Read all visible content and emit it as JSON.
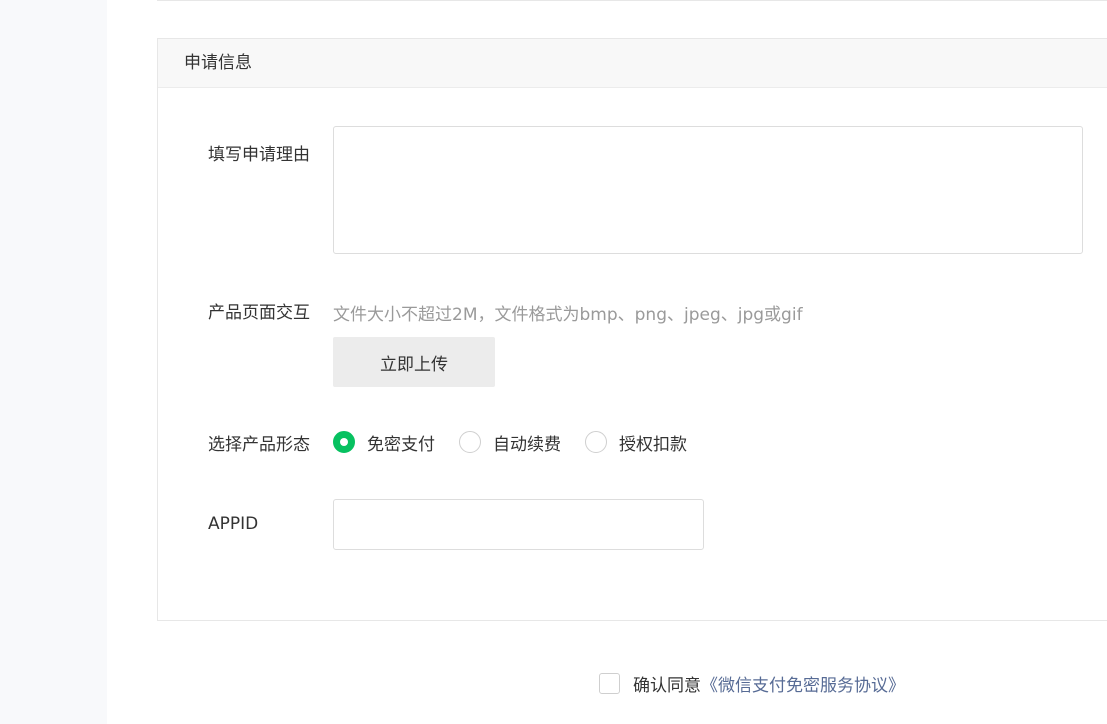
{
  "section": {
    "title": "申请信息"
  },
  "form": {
    "reason": {
      "label": "填写申请理由",
      "value": "",
      "placeholder": ""
    },
    "product_page": {
      "label": "产品页面交互",
      "hint": "文件大小不超过2M，文件格式为bmp、png、jpeg、jpg或gif",
      "upload_label": "立即上传"
    },
    "product_form": {
      "label": "选择产品形态",
      "options": [
        {
          "label": "免密支付",
          "checked": true
        },
        {
          "label": "自动续费",
          "checked": false
        },
        {
          "label": "授权扣款",
          "checked": false
        }
      ]
    },
    "appid": {
      "label": "APPID",
      "value": "",
      "placeholder": ""
    }
  },
  "agreement": {
    "checked": false,
    "text": "确认同意",
    "link_text": "《微信支付免密服务协议》"
  },
  "colors": {
    "accent": "#07c160",
    "link": "#576b95",
    "hint": "#9a9a9a"
  }
}
